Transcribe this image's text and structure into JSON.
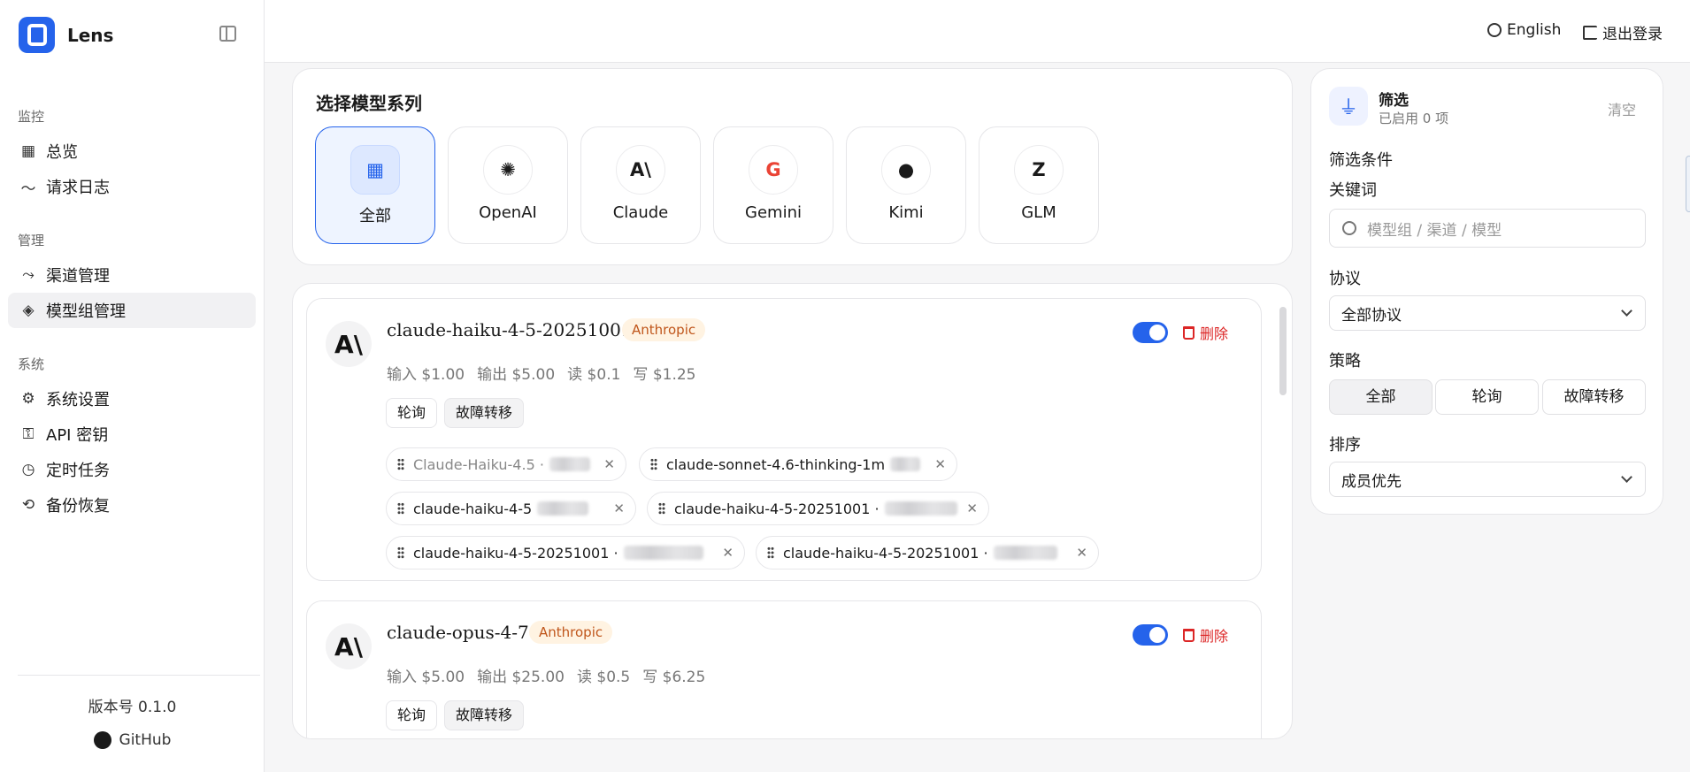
{
  "brand": {
    "name": "Lens"
  },
  "sidebar": {
    "sections": [
      {
        "title": "监控",
        "items": [
          {
            "label": "总览",
            "icon": "dashboard-icon"
          },
          {
            "label": "请求日志",
            "icon": "activity-icon"
          }
        ]
      },
      {
        "title": "管理",
        "items": [
          {
            "label": "渠道管理",
            "icon": "route-icon"
          },
          {
            "label": "模型组管理",
            "icon": "layers-icon",
            "active": true
          }
        ]
      },
      {
        "title": "系统",
        "items": [
          {
            "label": "系统设置",
            "icon": "sliders-icon"
          },
          {
            "label": "API 密钥",
            "icon": "key-icon"
          },
          {
            "label": "定时任务",
            "icon": "calendar-clock-icon"
          },
          {
            "label": "备份恢复",
            "icon": "backup-icon"
          }
        ]
      }
    ],
    "version": "版本号 0.1.0",
    "github": "GitHub"
  },
  "header": {
    "language": "English",
    "logout": "退出登录"
  },
  "series": {
    "title": "选择模型系列",
    "tiles": [
      {
        "label": "全部",
        "icon": "grid-icon",
        "selected": true
      },
      {
        "label": "OpenAI",
        "icon": "openai-icon"
      },
      {
        "label": "Claude",
        "icon": "anthropic-icon"
      },
      {
        "label": "Gemini",
        "icon": "google-icon"
      },
      {
        "label": "Kimi",
        "icon": "kimi-icon"
      },
      {
        "label": "GLM",
        "icon": "glm-icon"
      }
    ]
  },
  "models": [
    {
      "name": "claude-haiku-4-5-20251001",
      "provider": "Anthropic",
      "prices": [
        "输入 $1.00",
        "输出 $5.00",
        "读 $0.1",
        "写 $1.25"
      ],
      "strategies": [
        "轮询",
        "故障转移"
      ],
      "enabled": true,
      "delete": "删除",
      "members": [
        {
          "label": "Claude-Haiku-4.5 ·",
          "disabled": true
        },
        {
          "label": "claude-sonnet-4.6-thinking-1m"
        },
        {
          "label": "claude-haiku-4-5"
        },
        {
          "label": "claude-haiku-4-5-20251001 ·"
        },
        {
          "label": "claude-haiku-4-5-20251001 ·"
        },
        {
          "label": "claude-haiku-4-5-20251001 ·"
        }
      ]
    },
    {
      "name": "claude-opus-4-7",
      "provider": "Anthropic",
      "prices": [
        "输入 $5.00",
        "输出 $25.00",
        "读 $0.5",
        "写 $6.25"
      ],
      "strategies": [
        "轮询",
        "故障转移"
      ],
      "enabled": true,
      "delete": "删除"
    }
  ],
  "filter": {
    "title": "筛选",
    "subtitle": "已启用 0 项",
    "clear": "清空",
    "conditions": "筛选条件",
    "keyword_label": "关键词",
    "keyword_placeholder": "模型组 / 渠道 / 模型",
    "protocol_label": "协议",
    "protocol_value": "全部协议",
    "strategy_label": "策略",
    "strategies": [
      "全部",
      "轮询",
      "故障转移"
    ],
    "sort_label": "排序",
    "sort_value": "成员优先"
  },
  "colors": {
    "accent": "#2563eb",
    "danger": "#dc2626",
    "badge_bg": "#fff3e2",
    "badge_text": "#c0561b"
  }
}
